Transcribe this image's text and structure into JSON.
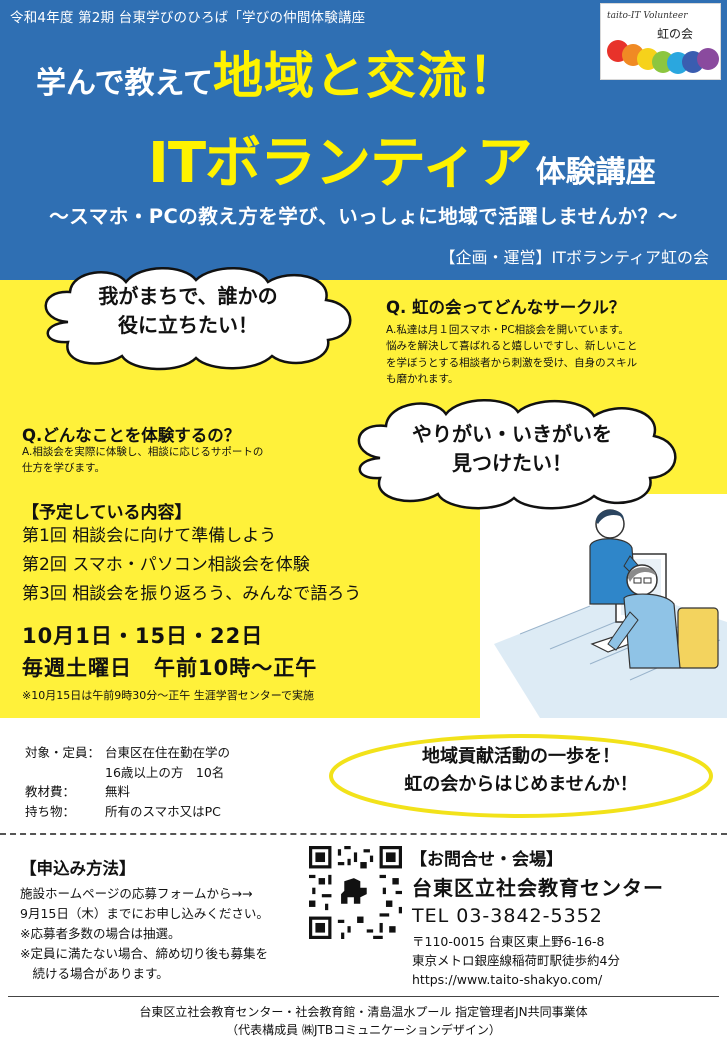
{
  "header": {
    "series": "令和4年度 第2期 台東学びのひろば「学びの仲間体験講座",
    "line1_small": "学んで教えて",
    "line1_big": "地域と交流！",
    "line2_big": "ITボランティア",
    "line2_small": "体験講座",
    "subtitle": "～スマホ・PCの教え方を学び、いっしょに地域で活躍しませんか？～",
    "organizer": "【企画・運営】ITボランティア虹の会"
  },
  "logo": {
    "en": "taito-IT Volunteer",
    "jp": "虹の会",
    "dot_colors": [
      "#e8322a",
      "#f08a24",
      "#f6d21b",
      "#8cc63f",
      "#2aa7df",
      "#3a5db0",
      "#8a4a9e"
    ]
  },
  "cloud1": {
    "line1": "我がまちで、誰かの",
    "line2": "役に立ちたい！"
  },
  "cloud2": {
    "line1": "やりがい・いきがいを",
    "line2": "見つけたい！"
  },
  "qa1": {
    "q": "Q. 虹の会ってどんなサークル？",
    "a1": "A.私達は月１回スマホ・PC相談会を開いています。",
    "a2": "悩みを解決して喜ばれると嬉しいですし、新しいこと",
    "a3": "を学ぼうとする相談者から刺激を受け、自身のスキル",
    "a4": "も磨かれます。"
  },
  "qa2": {
    "q": "Q.どんなことを体験するの？",
    "a1": "A.相談会を実際に体験し、相談に応じるサポートの",
    "a2": "仕方を学びます。"
  },
  "plan": {
    "title": "【予定している内容】",
    "items": [
      "第1回 相談会に向けて準備しよう",
      "第2回 スマホ・パソコン相談会を体験",
      "第3回 相談会を振り返ろう、みんなで語ろう"
    ]
  },
  "schedule": {
    "dates": "10月1日・15日・22日",
    "time": "毎週土曜日　午前10時～正午",
    "note": "※10月15日は午前9時30分～正午 生涯学習センターで実施"
  },
  "details": {
    "target_label": "対象・定員：",
    "target_value1": "台東区在住在勤在学の",
    "target_value2": "16歳以上の方　10名",
    "fee_label": "教材費：",
    "fee_value": "無料",
    "items_label": "持ち物：",
    "items_value": "所有のスマホ又はPC"
  },
  "oval": {
    "line1": "地域貢献活動の一歩を！",
    "line2": "虹の会からはじめませんか！"
  },
  "apply": {
    "title": "【申込み方法】",
    "lines": [
      "施設ホームページの応募フォームから→→",
      "9月15日（木）までにお申し込みください。",
      "※応募者多数の場合は抽選。",
      "※定員に満たない場合、締め切り後も募集を",
      "　続ける場合があります。"
    ]
  },
  "contact": {
    "title": "【お問合せ・会場】",
    "name": "台東区立社会教育センター",
    "tel": "TEL 03-3842-5352",
    "addr1": "〒110-0015 台東区東上野6-16-8",
    "addr2": "東京メトロ銀座線稲荷町駅徒歩約4分",
    "url": "https://www.taito-shakyo.com/"
  },
  "footer": {
    "line1": "台東区立社会教育センター・社会教育館・清島温水プール 指定管理者JN共同事業体",
    "line2": "（代表構成員 ㈱JTBコミュニケーションデザイン）"
  },
  "colors": {
    "blue": "#2f6fb3",
    "yellow": "#fff13a",
    "headline_yellow": "#fff200"
  }
}
